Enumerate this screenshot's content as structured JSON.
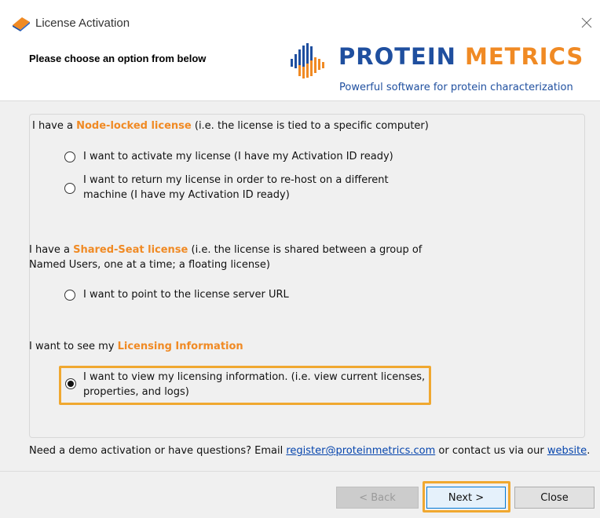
{
  "window": {
    "title": "License Activation",
    "accent": "#f08a24",
    "brand_blue": "#1f4f9f"
  },
  "header": {
    "subtitle": "Please choose an option from below",
    "logo_word1": "PROTEIN",
    "logo_word2": "METRICS",
    "tagline": "Powerful software for protein characterization"
  },
  "node_locked": {
    "prefix": "I have a ",
    "highlight": "Node-locked license",
    "suffix": " (i.e. the license is tied to a specific computer)",
    "options": [
      {
        "line1": "I want to activate my license (I have my Activation ID ready)",
        "line2": ""
      },
      {
        "line1": "I want to return my license in order to re-host on a different",
        "line2": "machine (I have my Activation ID ready)"
      }
    ]
  },
  "shared_seat": {
    "prefix": "I have a ",
    "highlight": "Shared-Seat license",
    "suffix": " (i.e. the license is shared between a group of",
    "line2": "Named Users, one at a time; a floating license)",
    "option": "I want to point to the license server URL"
  },
  "licensing_info": {
    "prefix": "I want to see my ",
    "highlight": "Licensing Information",
    "option_line1": "I want to view my licensing information. (i.e. view current licenses,",
    "option_line2": "properties, and logs)",
    "selected": true
  },
  "footer": {
    "text1": "Need a demo activation or have questions? Email ",
    "email": "register@proteinmetrics.com",
    "text2": " or contact us via our ",
    "website": "website",
    "text3": "."
  },
  "buttons": {
    "back": "< Back",
    "next": "Next >",
    "close": "Close"
  }
}
